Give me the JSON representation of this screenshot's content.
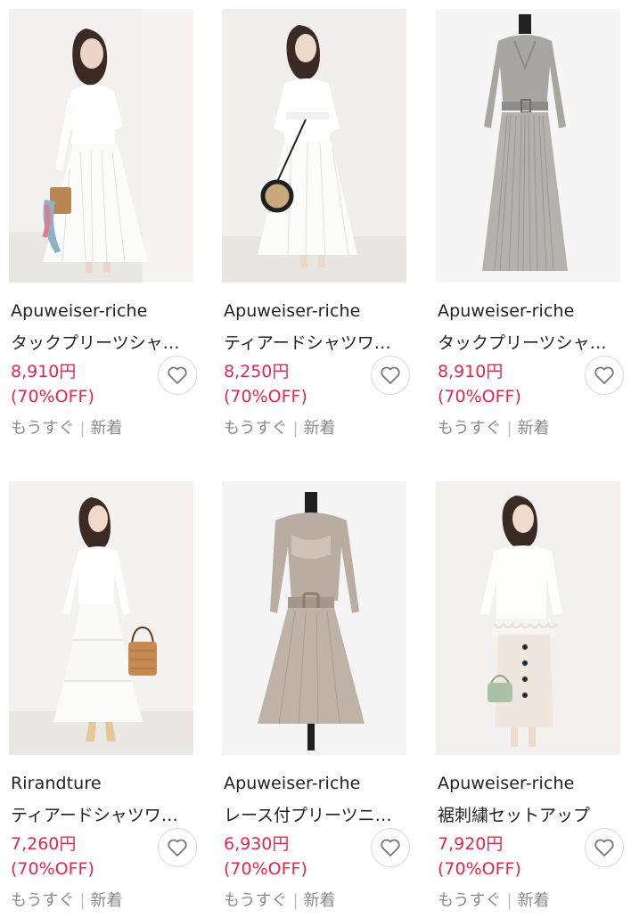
{
  "products": [
    {
      "brand": "Apuweiser-riche",
      "name": "タックプリーツシャ…",
      "price": "8,910円",
      "discount": "(70%OFF)",
      "ship": "もうすぐ",
      "tag": "新着",
      "image": "white-pleated-dress-model"
    },
    {
      "brand": "Apuweiser-riche",
      "name": "ティアードシャツワ…",
      "price": "8,250円",
      "discount": "(70%OFF)",
      "ship": "もうすぐ",
      "tag": "新着",
      "image": "white-shirt-dress-model"
    },
    {
      "brand": "Apuweiser-riche",
      "name": "タックプリーツシャ…",
      "price": "8,910円",
      "discount": "(70%OFF)",
      "ship": "もうすぐ",
      "tag": "新着",
      "image": "gray-pleated-dress-mannequin"
    },
    {
      "brand": "Rirandture",
      "name": "ティアードシャツワ…",
      "price": "7,260円",
      "discount": "(70%OFF)",
      "ship": "もうすぐ",
      "tag": "新着",
      "image": "white-tiered-dress-model"
    },
    {
      "brand": "Apuweiser-riche",
      "name": "レース付プリーツニ…",
      "price": "6,930円",
      "discount": "(70%OFF)",
      "ship": "もうすぐ",
      "tag": "新着",
      "image": "beige-knit-dress-mannequin"
    },
    {
      "brand": "Apuweiser-riche",
      "name": "裾刺繍セットアップ",
      "price": "7,920円",
      "discount": "(70%OFF)",
      "ship": "もうすぐ",
      "tag": "新着",
      "image": "white-setup-model"
    }
  ],
  "icons": {
    "favorite": "heart-outline-icon"
  },
  "colors": {
    "price": "#e0284d",
    "meta": "#8a8a8a",
    "text": "#222222"
  }
}
